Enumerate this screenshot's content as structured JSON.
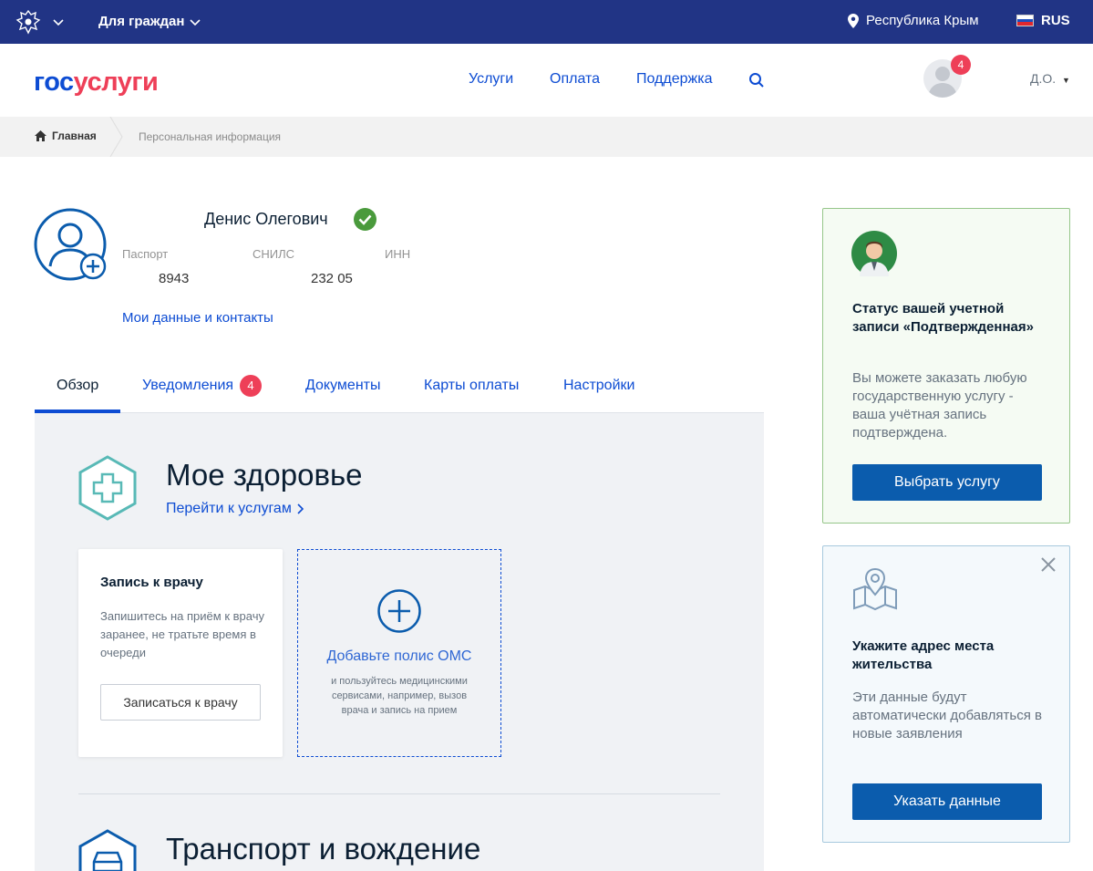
{
  "topbar": {
    "citizens_label": "Для граждан",
    "region": "Республика Крым",
    "language": "RUS"
  },
  "header": {
    "logo_part1": "гос",
    "logo_part2": "услуги",
    "nav": [
      "Услуги",
      "Оплата",
      "Поддержка"
    ],
    "notifications_count": "4",
    "user_short": "Д.О."
  },
  "breadcrumb": {
    "home": "Главная",
    "current": "Персональная информация"
  },
  "profile": {
    "name": "Денис Олегович",
    "passport_label": "Паспорт",
    "passport_value": "8943",
    "snils_label": "СНИЛС",
    "snils_value": "232 05",
    "inn_label": "ИНН",
    "my_data_link": "Мои данные и контакты"
  },
  "tabs": {
    "overview": "Обзор",
    "notifications": "Уведомления",
    "notifications_badge": "4",
    "documents": "Документы",
    "payment_cards": "Карты оплаты",
    "settings": "Настройки"
  },
  "health": {
    "title": "Мое здоровье",
    "link": "Перейти к услугам",
    "card": {
      "title": "Запись к врачу",
      "text": "Запишитесь на приём к врачу заранее, не тратьте время в очереди",
      "button": "Записаться к врачу"
    },
    "oms": {
      "title": "Добавьте полис ОМС",
      "text": "и пользуйтесь медицинскими сервисами, например, вызов врача и запись на прием"
    }
  },
  "transport": {
    "title": "Транспорт и вождение"
  },
  "status_card": {
    "title": "Статус вашей учетной записи «Подтвержденная»",
    "text": "Вы можете заказать любую государственную услугу - ваша учётная запись подтверждена.",
    "button": "Выбрать услугу"
  },
  "address_card": {
    "title": "Укажите адрес места жительства",
    "text": "Эти данные будут автоматически добавляться в новые заявления",
    "button": "Указать данные"
  },
  "colors": {
    "topbar": "#213485",
    "link": "#0d4cd3",
    "badge": "#ee3f58",
    "button": "#0b5cad",
    "verified": "#4a9a3c"
  }
}
